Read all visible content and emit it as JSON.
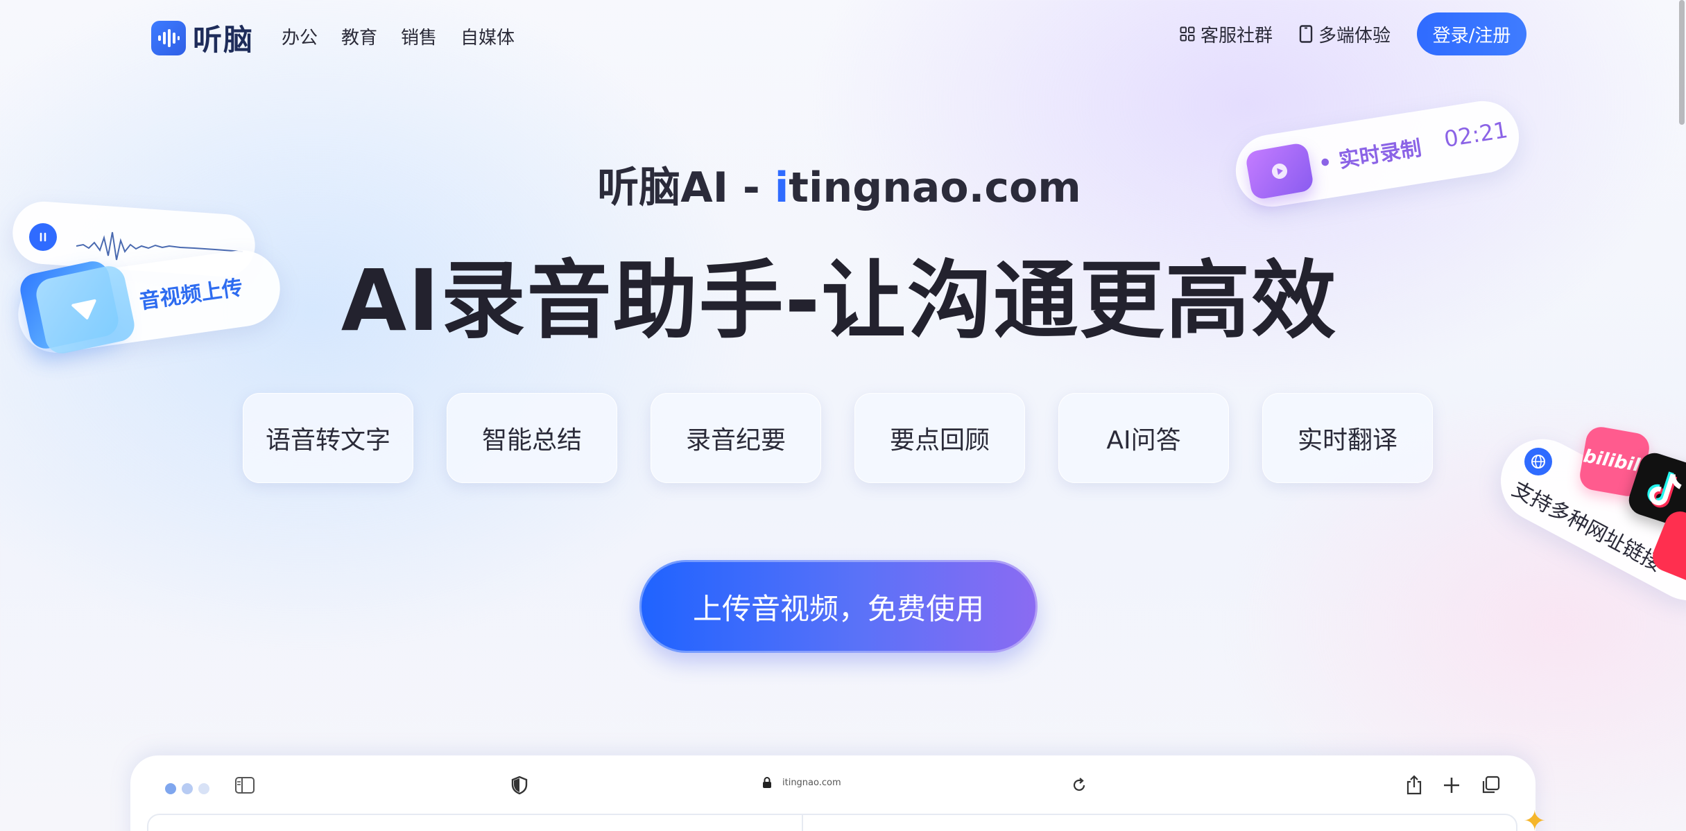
{
  "header": {
    "logo_text": "听脑",
    "nav": [
      "办公",
      "教育",
      "销售",
      "自媒体"
    ],
    "community_label": "客服社群",
    "multi_device_label": "多端体验",
    "login_label": "登录/注册"
  },
  "hero": {
    "subtitle_prefix": "听脑AI - ",
    "subtitle_highlight": "i",
    "subtitle_suffix": "tingnao.com",
    "title": "AI录音助手-让沟通更高效",
    "features": [
      "语音转文字",
      "智能总结",
      "录音纪要",
      "要点回顾",
      "AI问答",
      "实时翻译"
    ],
    "cta_label": "上传音视频，免费使用"
  },
  "floating": {
    "upload_label": "音视频上传",
    "record_label": "• 实时录制",
    "record_time": "02:21",
    "links_label": "支持多种网址链接",
    "bili_label": "bilibili"
  },
  "browser": {
    "url": "itingnao.com"
  },
  "colors": {
    "brand_blue": "#2f6bff",
    "title_dark": "#23222e",
    "record_purple": "#8b63e6"
  },
  "icons": {
    "grid": "grid-icon",
    "phone": "phone-icon",
    "shield": "shield-icon",
    "lock": "lock-icon",
    "reload": "reload-icon",
    "share": "share-icon",
    "plus": "plus-icon",
    "tabs": "tabs-icon",
    "sidebar": "sidebar-icon"
  }
}
